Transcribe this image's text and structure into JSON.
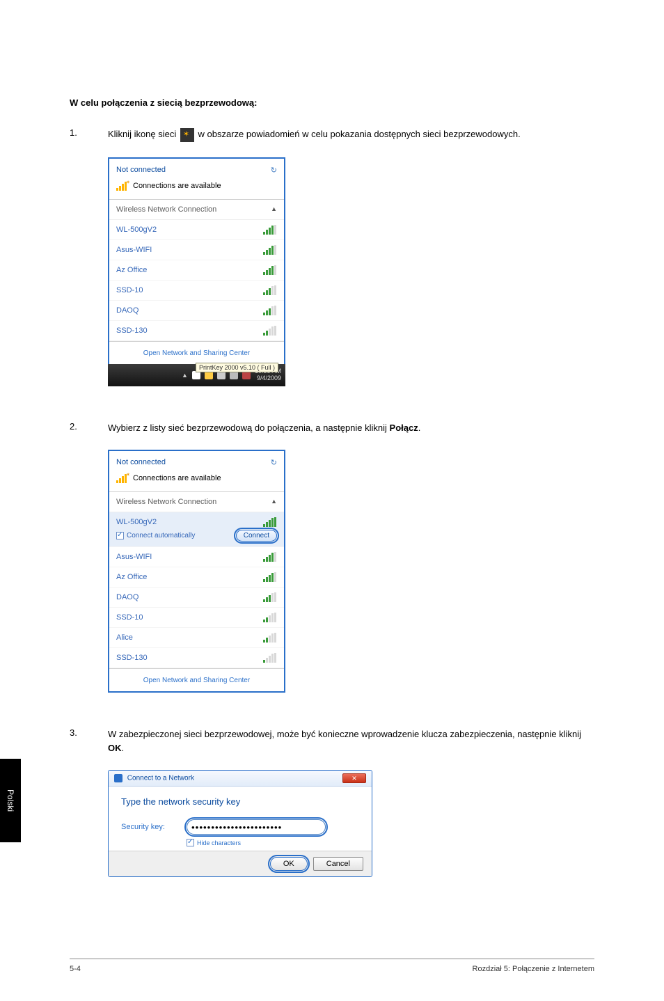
{
  "side_tab": "Polski",
  "heading": "W celu połączenia z siecią bezprzewodową:",
  "step1": {
    "num": "1.",
    "text_before": "Kliknij ikonę sieci ",
    "text_after": " w obszarze powiadomień w celu pokazania dostępnych sieci bezprzewodowych."
  },
  "panel1": {
    "title": "Not connected",
    "avail": "Connections are available",
    "list_header": "Wireless Network Connection",
    "items": [
      {
        "ssid": "WL-500gV2",
        "sig": "sig-green4"
      },
      {
        "ssid": "Asus-WIFI",
        "sig": "sig-green4"
      },
      {
        "ssid": "Az Office",
        "sig": "sig-green4"
      },
      {
        "ssid": "SSD-10",
        "sig": "sig-green3"
      },
      {
        "ssid": "DAOQ",
        "sig": "sig-green3"
      },
      {
        "ssid": "SSD-130",
        "sig": "sig-green2"
      }
    ],
    "footer_link": "Open Network and Sharing Center",
    "tooltip": "PrintKey 2000  v5.10 ( Full )",
    "time": "10:35 AM",
    "date": "9/4/2009"
  },
  "step2": {
    "num": "2.",
    "text_before": "Wybierz z listy sieć bezprzewodową do połączenia, a następnie kliknij ",
    "bold": "Połącz",
    "text_after": "."
  },
  "panel2": {
    "title": "Not connected",
    "avail": "Connections are available",
    "list_header": "Wireless Network Connection",
    "highlight": {
      "ssid": "WL-500gV2",
      "auto": "Connect automatically",
      "connect": "Connect"
    },
    "items": [
      {
        "ssid": "Asus-WIFI",
        "sig": "sig-green4"
      },
      {
        "ssid": "Az Office",
        "sig": "sig-green4"
      },
      {
        "ssid": "DAOQ",
        "sig": "sig-green3"
      },
      {
        "ssid": "SSD-10",
        "sig": "sig-green2"
      },
      {
        "ssid": "Alice",
        "sig": "sig-green2"
      },
      {
        "ssid": "SSD-130",
        "sig": "sig-green1"
      }
    ],
    "footer_link": "Open Network and Sharing Center"
  },
  "step3": {
    "num": "3.",
    "text_before": "W zabezpieczonej sieci bezprzewodowej, może być konieczne wprowadzenie klucza zabezpieczenia, następnie kliknij ",
    "bold": "OK",
    "text_after": "."
  },
  "dialog": {
    "title": "Connect to a Network",
    "heading": "Type the network security key",
    "label": "Security key:",
    "input_mask": "•••••••••••••••••••••••",
    "hide": "Hide characters",
    "ok": "OK",
    "cancel": "Cancel"
  },
  "footer": {
    "left": "5-4",
    "right": "Rozdział 5: Połączenie z Internetem"
  }
}
